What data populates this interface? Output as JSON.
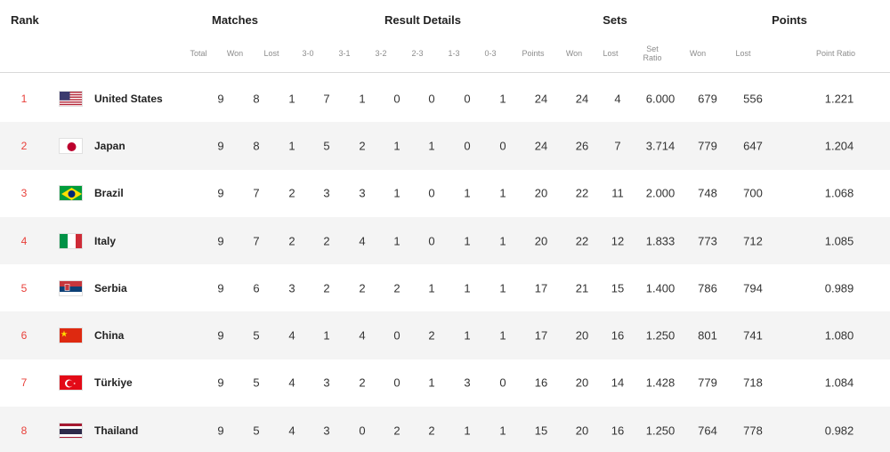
{
  "headers": {
    "rank": "Rank",
    "matches": "Matches",
    "result_details": "Result Details",
    "sets": "Sets",
    "points": "Points"
  },
  "subheaders": {
    "total": "Total",
    "won": "Won",
    "lost": "Lost",
    "r30": "3-0",
    "r31": "3-1",
    "r32": "3-2",
    "r23": "2-3",
    "r13": "1-3",
    "r03": "0-3",
    "points": "Points",
    "sets_won": "Won",
    "sets_lost": "Lost",
    "set_ratio_1": "Set",
    "set_ratio_2": "Ratio",
    "pts_won": "Won",
    "pts_lost": "Lost",
    "point_ratio": "Point Ratio"
  },
  "teams": [
    {
      "rank": "1",
      "name": "United States",
      "flag": "usa-flag",
      "total": "9",
      "won": "8",
      "lost": "1",
      "r30": "7",
      "r31": "1",
      "r32": "0",
      "r23": "0",
      "r13": "0",
      "r03": "1",
      "points": "24",
      "sets_won": "24",
      "sets_lost": "4",
      "set_ratio": "6.000",
      "pts_won": "679",
      "pts_lost": "556",
      "point_ratio": "1.221"
    },
    {
      "rank": "2",
      "name": "Japan",
      "flag": "japan-flag",
      "total": "9",
      "won": "8",
      "lost": "1",
      "r30": "5",
      "r31": "2",
      "r32": "1",
      "r23": "1",
      "r13": "0",
      "r03": "0",
      "points": "24",
      "sets_won": "26",
      "sets_lost": "7",
      "set_ratio": "3.714",
      "pts_won": "779",
      "pts_lost": "647",
      "point_ratio": "1.204"
    },
    {
      "rank": "3",
      "name": "Brazil",
      "flag": "brazil-flag",
      "total": "9",
      "won": "7",
      "lost": "2",
      "r30": "3",
      "r31": "3",
      "r32": "1",
      "r23": "0",
      "r13": "1",
      "r03": "1",
      "points": "20",
      "sets_won": "22",
      "sets_lost": "11",
      "set_ratio": "2.000",
      "pts_won": "748",
      "pts_lost": "700",
      "point_ratio": "1.068"
    },
    {
      "rank": "4",
      "name": "Italy",
      "flag": "italy-flag",
      "total": "9",
      "won": "7",
      "lost": "2",
      "r30": "2",
      "r31": "4",
      "r32": "1",
      "r23": "0",
      "r13": "1",
      "r03": "1",
      "points": "20",
      "sets_won": "22",
      "sets_lost": "12",
      "set_ratio": "1.833",
      "pts_won": "773",
      "pts_lost": "712",
      "point_ratio": "1.085"
    },
    {
      "rank": "5",
      "name": "Serbia",
      "flag": "serbia-flag",
      "total": "9",
      "won": "6",
      "lost": "3",
      "r30": "2",
      "r31": "2",
      "r32": "2",
      "r23": "1",
      "r13": "1",
      "r03": "1",
      "points": "17",
      "sets_won": "21",
      "sets_lost": "15",
      "set_ratio": "1.400",
      "pts_won": "786",
      "pts_lost": "794",
      "point_ratio": "0.989"
    },
    {
      "rank": "6",
      "name": "China",
      "flag": "china-flag",
      "total": "9",
      "won": "5",
      "lost": "4",
      "r30": "1",
      "r31": "4",
      "r32": "0",
      "r23": "2",
      "r13": "1",
      "r03": "1",
      "points": "17",
      "sets_won": "20",
      "sets_lost": "16",
      "set_ratio": "1.250",
      "pts_won": "801",
      "pts_lost": "741",
      "point_ratio": "1.080"
    },
    {
      "rank": "7",
      "name": "Türkiye",
      "flag": "turkiye-flag",
      "total": "9",
      "won": "5",
      "lost": "4",
      "r30": "3",
      "r31": "2",
      "r32": "0",
      "r23": "1",
      "r13": "3",
      "r03": "0",
      "points": "16",
      "sets_won": "20",
      "sets_lost": "14",
      "set_ratio": "1.428",
      "pts_won": "779",
      "pts_lost": "718",
      "point_ratio": "1.084"
    },
    {
      "rank": "8",
      "name": "Thailand",
      "flag": "thailand-flag",
      "total": "9",
      "won": "5",
      "lost": "4",
      "r30": "3",
      "r31": "0",
      "r32": "2",
      "r23": "2",
      "r13": "1",
      "r03": "1",
      "points": "15",
      "sets_won": "20",
      "sets_lost": "16",
      "set_ratio": "1.250",
      "pts_won": "764",
      "pts_lost": "778",
      "point_ratio": "0.982"
    }
  ],
  "colors": {
    "rank_accent": "#e8403a",
    "alt_row": "#f4f4f4",
    "subheader_text": "#8c8c8c"
  }
}
